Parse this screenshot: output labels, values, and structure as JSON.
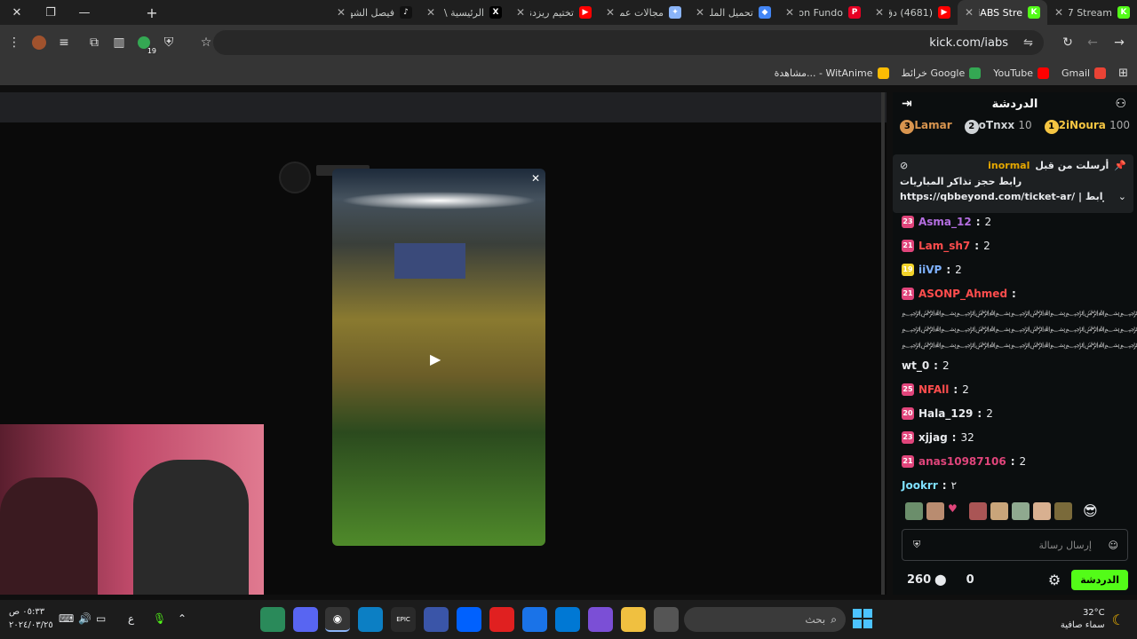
{
  "tabs": [
    {
      "title": "Nxv7 Stream",
      "fav_color": "#53fc18",
      "fav_letter": "K"
    },
    {
      "title": "iABS Stre",
      "fav_color": "#53fc18",
      "fav_letter": "K",
      "active": true
    },
    {
      "title": "(4681) دق دق",
      "fav_color": "#ff0000",
      "fav_letter": "▶"
    },
    {
      "title": "Pin on Fundo",
      "fav_color": "#e60023",
      "fav_letter": "P"
    },
    {
      "title": "تحميل الملف",
      "fav_color": "#4285f4",
      "fav_letter": "◆"
    },
    {
      "title": "مجالات عمل",
      "fav_color": "#8ab4f8",
      "fav_letter": "✦"
    },
    {
      "title": "تختيم ريزدنت",
      "fav_color": "#ff0000",
      "fav_letter": "▶"
    },
    {
      "title": "الرئيسية \\ X (1)",
      "fav_color": "#000000",
      "fav_letter": "X"
    },
    {
      "title": "فيصل الشهرا",
      "fav_color": "#111111",
      "fav_letter": "♪"
    }
  ],
  "address": {
    "url": "kick.com/iabs"
  },
  "toolbar": {
    "extension_count": "19"
  },
  "bookmarks": [
    {
      "label": "Gmail",
      "color": "#ea4335"
    },
    {
      "label": "YouTube",
      "color": "#ff0000"
    },
    {
      "label": "خرائط Google",
      "color": "#34a853"
    },
    {
      "label": "مشاهدة... - WitAnime",
      "color": "#fbbc04"
    }
  ],
  "chat": {
    "title": "الدردشة",
    "leaderboard": [
      {
        "rank": "1",
        "name": "2iNoura",
        "score": "100",
        "color": "#f5c542"
      },
      {
        "rank": "2",
        "name": "oTnxx",
        "score": "10",
        "color": "#cfd3d6"
      },
      {
        "rank": "3",
        "name": "Lamar",
        "score": "",
        "color": "#d9954f"
      }
    ],
    "pinned": {
      "by_user": "inormal",
      "by_label": "أرسلت من قبل",
      "title": "رابط حجز تذاكر المباريات",
      "link": "https://qbbeyond.com/ticket-ar/ | رابط"
    },
    "messages": [
      {
        "badge": "23",
        "badge_color": "#e0457b",
        "user": "Asma_12",
        "user_color": "#b46ee0",
        "text": "2"
      },
      {
        "badge": "21",
        "badge_color": "#e0457b",
        "user": "Lam_sh7",
        "user_color": "#ff4d4d",
        "text": "2"
      },
      {
        "badge": "19",
        "badge_color": "#f2d32a",
        "user": "iiVP",
        "user_color": "#7fb2ff",
        "text": "2"
      },
      {
        "badge": "21",
        "badge_color": "#e0457b",
        "user": "ASONP_Ahmed",
        "user_color": "#ff4d4d",
        "text": ""
      },
      {
        "badge": "",
        "badge_color": "",
        "user": "wt_0",
        "user_color": "#e8eaed",
        "text": "2"
      },
      {
        "badge": "25",
        "badge_color": "#e0457b",
        "user": "NFAll",
        "user_color": "#ff4d4d",
        "text": "2"
      },
      {
        "badge": "20",
        "badge_color": "#e0457b",
        "user": "Hala_129",
        "user_color": "#e8eaed",
        "text": "2"
      },
      {
        "badge": "23",
        "badge_color": "#e0457b",
        "user": "xjjag",
        "user_color": "#e8eaed",
        "text": "32"
      },
      {
        "badge": "21",
        "badge_color": "#e0457b",
        "user": "anas10987106",
        "user_color": "#e0457b",
        "text": "2"
      },
      {
        "badge": "",
        "badge_color": "",
        "user": "Jookrr",
        "user_color": "#7fe0ff",
        "text": "٢"
      }
    ],
    "spam_lines": [
      "﷽﷽﷽﷽﷽﷽﷽﷽﷽﷽﷽﷽﷽﷽﷽﷽﷽",
      "﷽﷽﷽﷽﷽﷽﷽﷽﷽﷽﷽﷽﷽﷽﷽﷽﷽",
      "﷽﷽﷽﷽﷽﷽﷽﷽﷽﷽﷽﷽"
    ],
    "input_placeholder": "إرسال رسالة",
    "send_label": "الدردشة",
    "points": "260",
    "zero": "0"
  },
  "taskbar": {
    "time": "٠٥:٣٣ ص",
    "date": "٢٠٢٤/٠٣/٢٥",
    "lang": "ع",
    "weather_temp": "32°C",
    "weather_desc": "سماء صافية",
    "search_label": "بحث"
  }
}
